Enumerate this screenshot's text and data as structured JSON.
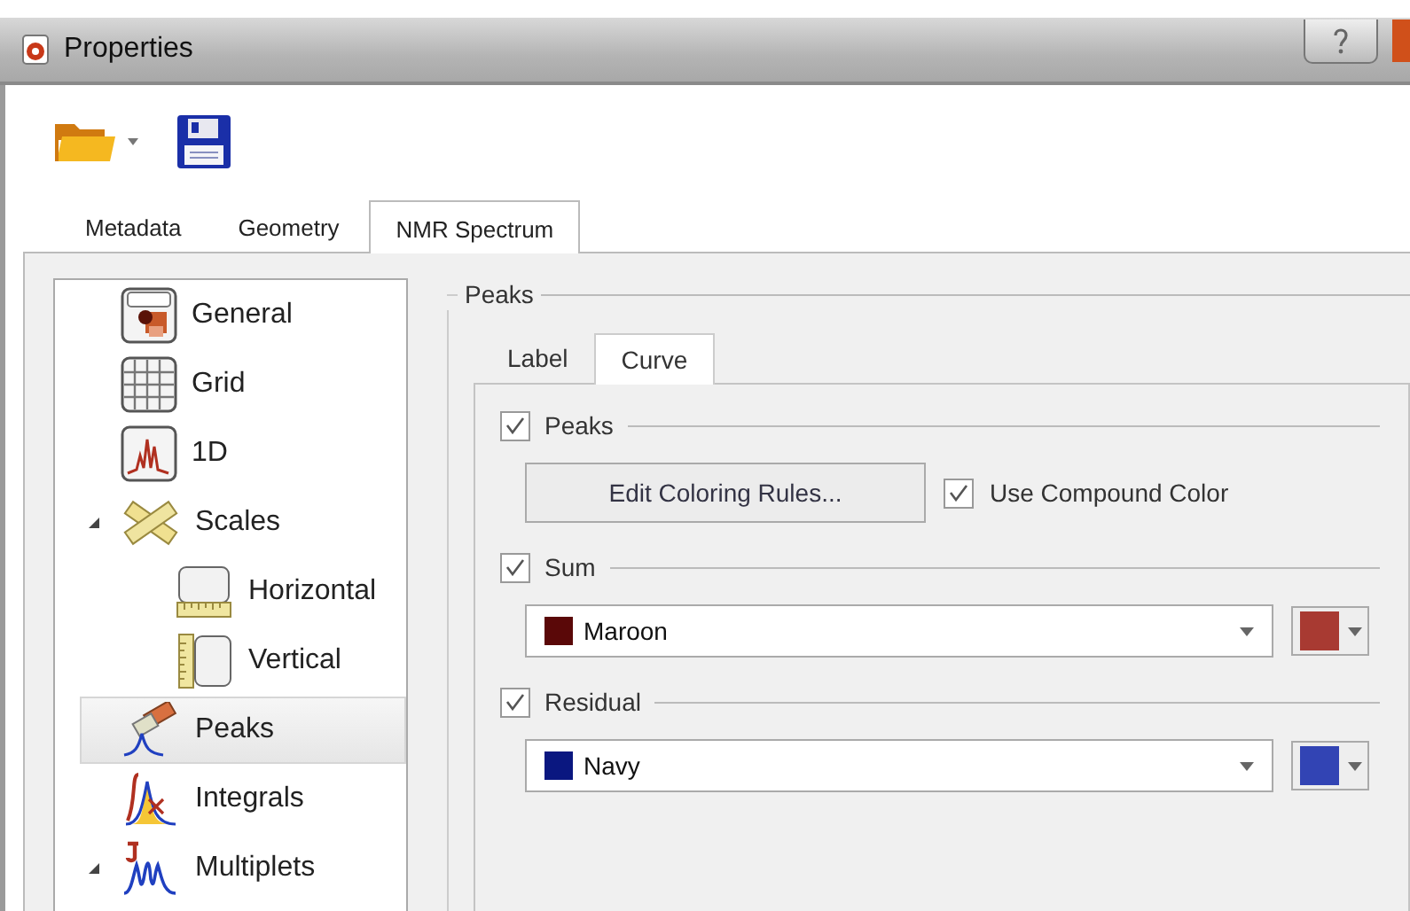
{
  "window": {
    "title": "Properties"
  },
  "tabs": [
    {
      "label": "Metadata",
      "selected": false
    },
    {
      "label": "Geometry",
      "selected": false
    },
    {
      "label": "NMR Spectrum",
      "selected": true
    }
  ],
  "tree": [
    {
      "label": "General",
      "kind": "title",
      "selected": false
    },
    {
      "label": "Grid",
      "kind": "grid",
      "selected": false
    },
    {
      "label": "1D",
      "kind": "spectrum",
      "selected": false
    },
    {
      "label": "Scales",
      "kind": "rulers",
      "selected": false,
      "expanded": true,
      "children": [
        {
          "label": "Horizontal",
          "kind": "hscale",
          "selected": false
        },
        {
          "label": "Vertical",
          "kind": "vscale",
          "selected": false
        }
      ]
    },
    {
      "label": "Peaks",
      "kind": "peaks",
      "selected": true
    },
    {
      "label": "Integrals",
      "kind": "integrals",
      "selected": false
    },
    {
      "label": "Multiplets",
      "kind": "multiplets",
      "selected": false,
      "expanded": true
    }
  ],
  "group": {
    "title": "Peaks",
    "subtabs": [
      {
        "label": "Label",
        "selected": false
      },
      {
        "label": "Curve",
        "selected": true
      }
    ],
    "sections": [
      {
        "kind": "rules",
        "label": "Peaks",
        "checked": true,
        "button": "Edit Coloring Rules...",
        "option": {
          "label": "Use Compound Color",
          "checked": true
        }
      },
      {
        "kind": "color",
        "label": "Sum",
        "checked": true,
        "value": "Maroon",
        "color": "#5a0808",
        "picker": {
          "color": "#a83a32"
        }
      },
      {
        "kind": "color",
        "label": "Residual",
        "checked": true,
        "value": "Navy",
        "color": "#0a1780",
        "picker": {
          "color": "#3244b4"
        }
      }
    ]
  }
}
